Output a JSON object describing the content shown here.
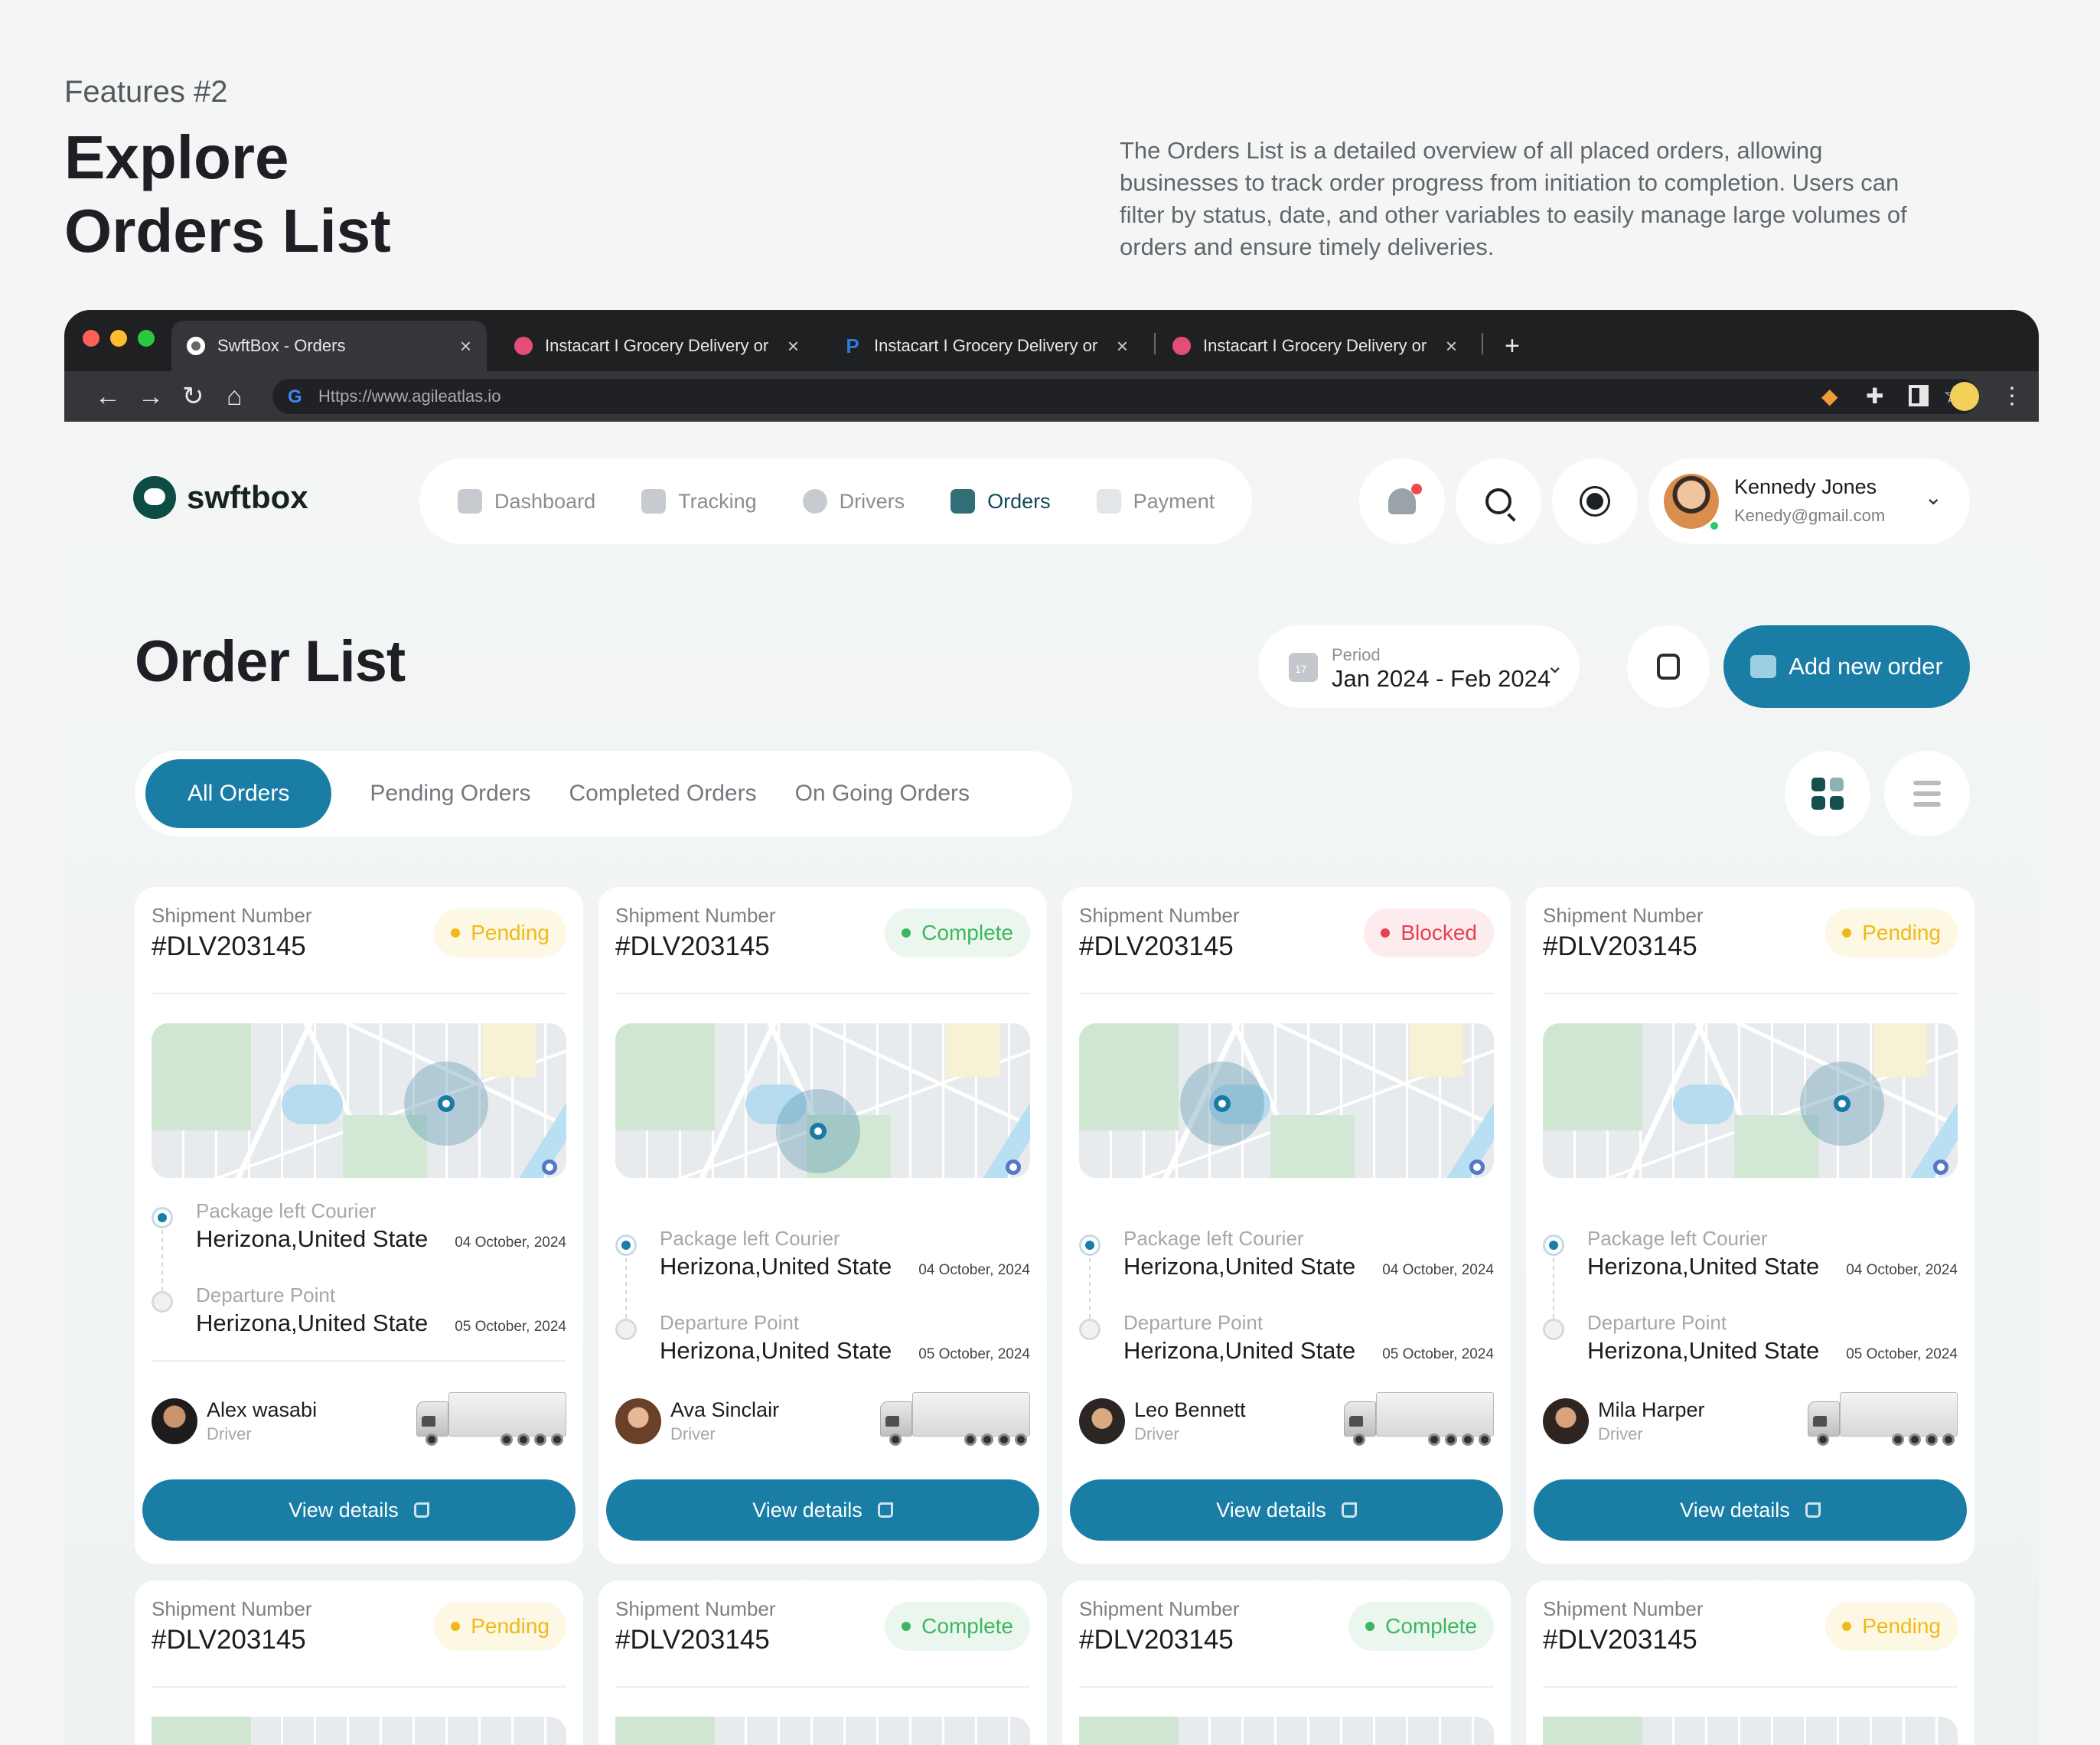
{
  "hero": {
    "kicker": "Features #2",
    "title_line1": "Explore",
    "title_line2": "Orders List",
    "description": "The Orders List is a detailed overview of all placed orders, allowing businesses to track order progress from initiation to completion. Users can filter by status, date, and other variables to easily manage large volumes of orders and ensure timely deliveries."
  },
  "browser": {
    "tabs": [
      {
        "title": "SwftBox - Orders",
        "active": true
      },
      {
        "title": "Instacart I Grocery Delivery or",
        "active": false
      },
      {
        "title": "Instacart I Grocery Delivery or",
        "active": false
      },
      {
        "title": "Instacart I Grocery Delivery or",
        "active": false
      }
    ],
    "close_glyph": "×",
    "new_tab_glyph": "+",
    "url": "Https://www.agileatlas.io",
    "google_glyph": "G",
    "icons": [
      "back-icon",
      "forward-icon",
      "reload-icon",
      "home-icon",
      "bookmark-star-icon",
      "extension-fox-icon",
      "puzzle-icon",
      "sidebar-icon",
      "profile-icon",
      "menu-icon"
    ]
  },
  "app": {
    "logo_text": "swftbox",
    "nav": [
      {
        "label": "Dashboard",
        "active": false,
        "icon": "grid-icon"
      },
      {
        "label": "Tracking",
        "active": false,
        "icon": "truck-icon"
      },
      {
        "label": "Drivers",
        "active": false,
        "icon": "users-icon"
      },
      {
        "label": "Orders",
        "active": true,
        "icon": "box-icon"
      },
      {
        "label": "Payment",
        "active": false,
        "icon": "card-icon"
      }
    ],
    "user": {
      "name": "Kennedy Jones",
      "email": "Kenedy@gmail.com",
      "status": "online"
    },
    "page_title": "Order List",
    "period": {
      "label": "Period",
      "value": "Jan 2024 - Feb 2024"
    },
    "add_button": "Add new order",
    "filters": [
      {
        "label": "All Orders",
        "active": true
      },
      {
        "label": "Pending Orders",
        "active": false
      },
      {
        "label": "Completed Orders",
        "active": false
      },
      {
        "label": "On Going Orders",
        "active": false
      }
    ],
    "view_mode": "grid"
  },
  "colors": {
    "primary": "#197da6",
    "pending": "#f0b91a",
    "complete": "#3eb55f",
    "blocked": "#e7404f",
    "brand_dark": "#0d4c45"
  },
  "cards": [
    {
      "shipment_label": "Shipment Number",
      "shipment_number": "#DLV203145",
      "status": "Pending",
      "status_class": "b-pending",
      "pickup": {
        "label": "Package left Courier",
        "place": "Herizona,United State",
        "date": "04 October, 2024"
      },
      "departure": {
        "label": "Departure Point",
        "place": "Herizona,United State",
        "date": "05 October, 2024"
      },
      "driver": {
        "name": "Alex wasabi",
        "role": "Driver"
      },
      "button": "View details"
    },
    {
      "shipment_label": "Shipment Number",
      "shipment_number": "#DLV203145",
      "status": "Complete",
      "status_class": "b-complete",
      "pickup": {
        "label": "Package left Courier",
        "place": "Herizona,United State",
        "date": "04 October, 2024"
      },
      "departure": {
        "label": "Departure Point",
        "place": "Herizona,United State",
        "date": "05 October, 2024"
      },
      "driver": {
        "name": "Ava Sinclair",
        "role": "Driver"
      },
      "button": "View details"
    },
    {
      "shipment_label": "Shipment Number",
      "shipment_number": "#DLV203145",
      "status": "Blocked",
      "status_class": "b-blocked",
      "pickup": {
        "label": "Package left Courier",
        "place": "Herizona,United State",
        "date": "04 October, 2024"
      },
      "departure": {
        "label": "Departure Point",
        "place": "Herizona,United State",
        "date": "05 October, 2024"
      },
      "driver": {
        "name": "Leo Bennett",
        "role": "Driver"
      },
      "button": "View details"
    },
    {
      "shipment_label": "Shipment Number",
      "shipment_number": "#DLV203145",
      "status": "Pending",
      "status_class": "b-pending",
      "pickup": {
        "label": "Package left Courier",
        "place": "Herizona,United State",
        "date": "04 October, 2024"
      },
      "departure": {
        "label": "Departure Point",
        "place": "Herizona,United State",
        "date": "05 October, 2024"
      },
      "driver": {
        "name": "Mila Harper",
        "role": "Driver"
      },
      "button": "View details"
    }
  ],
  "cards_row2": [
    {
      "shipment_label": "Shipment Number",
      "shipment_number": "#DLV203145",
      "status": "Pending",
      "status_class": "b-pending"
    },
    {
      "shipment_label": "Shipment Number",
      "shipment_number": "#DLV203145",
      "status": "Complete",
      "status_class": "b-complete"
    },
    {
      "shipment_label": "Shipment Number",
      "shipment_number": "#DLV203145",
      "status": "Complete",
      "status_class": "b-complete"
    },
    {
      "shipment_label": "Shipment Number",
      "shipment_number": "#DLV203145",
      "status": "Pending",
      "status_class": "b-pending"
    }
  ]
}
